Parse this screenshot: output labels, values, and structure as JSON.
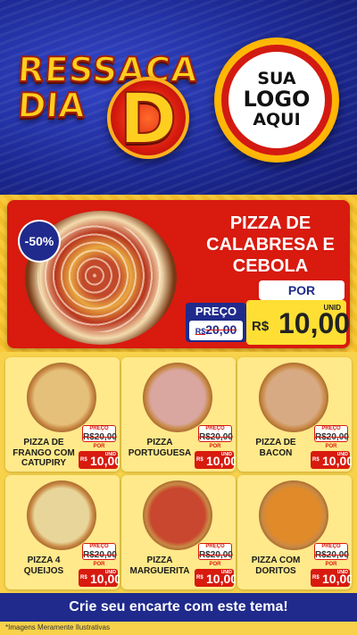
{
  "header": {
    "title_line1": "RESSACA",
    "title_line2": "DIA",
    "title_d": "D",
    "logo_lines": [
      "SUA",
      "LOGO",
      "AQUI"
    ]
  },
  "featured": {
    "discount": "-50%",
    "name": "PIZZA DE CALABRESA E CEBOLA",
    "preco_label": "PREÇO",
    "old_currency": "R$",
    "old_price": "20,00",
    "por_label": "POR",
    "currency": "R$",
    "price": "10,00",
    "unit": "UNID"
  },
  "products": [
    {
      "name": "PIZZA DE FRANGO COM CATUPIRY",
      "preco_label": "PREÇO",
      "old_price": "20,00",
      "old_currency": "R$",
      "por_label": "POR",
      "currency": "R$",
      "price": "10,00",
      "unit": "UNID",
      "pizza_color": "#e5c07a"
    },
    {
      "name": "PIZZA PORTUGUESA",
      "preco_label": "PREÇO",
      "old_price": "20,00",
      "old_currency": "R$",
      "por_label": "POR",
      "currency": "R$",
      "price": "10,00",
      "unit": "UNID",
      "pizza_color": "#d9a6a0"
    },
    {
      "name": "PIZZA DE BACON",
      "preco_label": "PREÇO",
      "old_price": "20,00",
      "old_currency": "R$",
      "por_label": "POR",
      "currency": "R$",
      "price": "10,00",
      "unit": "UNID",
      "pizza_color": "#d8aa84"
    },
    {
      "name": "PIZZA 4 QUEIJOS",
      "preco_label": "PREÇO",
      "old_price": "20,00",
      "old_currency": "R$",
      "por_label": "POR",
      "currency": "R$",
      "price": "10,00",
      "unit": "UNID",
      "pizza_color": "#e8d59a"
    },
    {
      "name": "PIZZA MARGUERITA",
      "preco_label": "PREÇO",
      "old_price": "20,00",
      "old_currency": "R$",
      "por_label": "POR",
      "currency": "R$",
      "price": "10,00",
      "unit": "UNID",
      "pizza_color": "#c9472f"
    },
    {
      "name": "PIZZA COM DORITOS",
      "preco_label": "PREÇO",
      "old_price": "20,00",
      "old_currency": "R$",
      "por_label": "POR",
      "currency": "R$",
      "price": "10,00",
      "unit": "UNID",
      "pizza_color": "#e08a2a"
    }
  ],
  "footer": {
    "cta": "Crie seu encarte com este tema!",
    "disclaimer": "*Imagens Meramente Ilustrativas"
  }
}
